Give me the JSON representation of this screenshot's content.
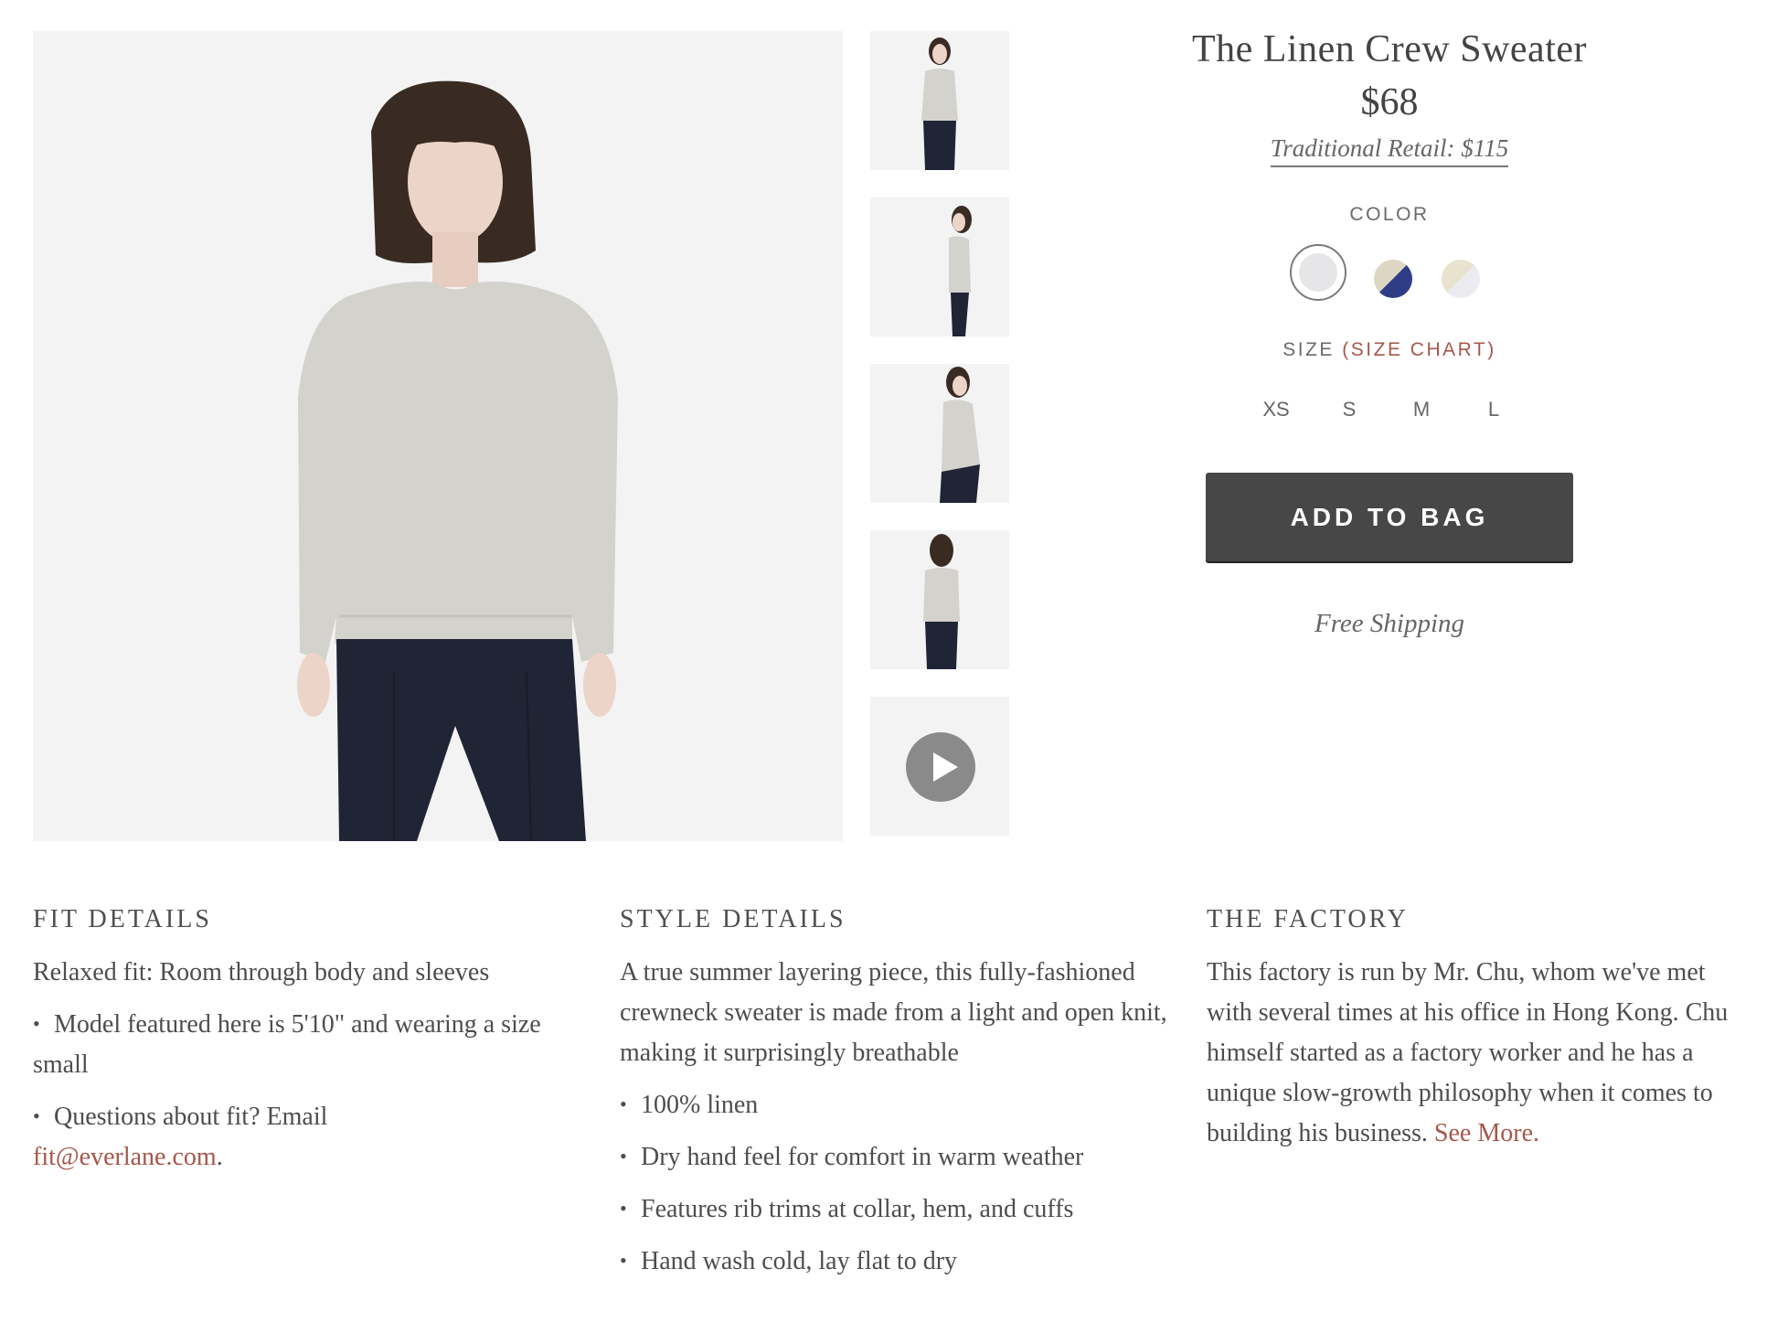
{
  "gallery": {
    "main_image": "model-front-linen-sweater",
    "thumbnails": [
      {
        "name": "thumb-front"
      },
      {
        "name": "thumb-side"
      },
      {
        "name": "thumb-pose"
      },
      {
        "name": "thumb-back"
      },
      {
        "name": "thumb-video",
        "icon": "play-icon"
      }
    ]
  },
  "product": {
    "title": "The Linen Crew Sweater",
    "price": "$68",
    "traditional_retail": "Traditional Retail: $115",
    "color_label": "COLOR",
    "colors": [
      {
        "name": "heather-grey",
        "primary": "#e6e6e8",
        "secondary": "#e6e6e8",
        "selected": true
      },
      {
        "name": "bone-navy",
        "primary": "#ddd6c2",
        "secondary": "#2f3d86",
        "selected": false
      },
      {
        "name": "bone-white",
        "primary": "#e9e2cf",
        "secondary": "#ececf0",
        "selected": false
      }
    ],
    "size_label": "SIZE",
    "size_chart_label": "(SIZE CHART)",
    "sizes": [
      "XS",
      "S",
      "M",
      "L"
    ],
    "add_to_bag_label": "ADD TO BAG",
    "free_shipping": "Free Shipping"
  },
  "details": {
    "fit": {
      "heading": "FIT DETAILS",
      "intro": "Relaxed fit: Room through body and sleeves",
      "bullets": [
        "Model featured here is 5'10\" and wearing a size small"
      ],
      "email_prefix": "Questions about fit? Email",
      "email": "fit@everlane.com",
      "email_suffix": "."
    },
    "style": {
      "heading": "STYLE DETAILS",
      "intro": "A true summer layering piece, this fully-fashioned crewneck sweater is made from a light and open knit, making it surprisingly breathable",
      "bullets": [
        "100% linen",
        "Dry hand feel for comfort in warm weather",
        "Features rib trims at collar, hem, and cuffs",
        "Hand wash cold, lay flat to dry"
      ]
    },
    "factory": {
      "heading": "THE FACTORY",
      "text": "This factory is run by Mr. Chu, whom we've met with several times at his office in Hong Kong. Chu himself started as a factory worker and he has a unique slow-growth philosophy when it comes to building his business.",
      "see_more": "See More."
    }
  },
  "colors": {
    "accent_link": "#a5574b",
    "button_bg": "#474747",
    "text": "#4a4a4a",
    "image_bg": "#f3f3f3"
  }
}
